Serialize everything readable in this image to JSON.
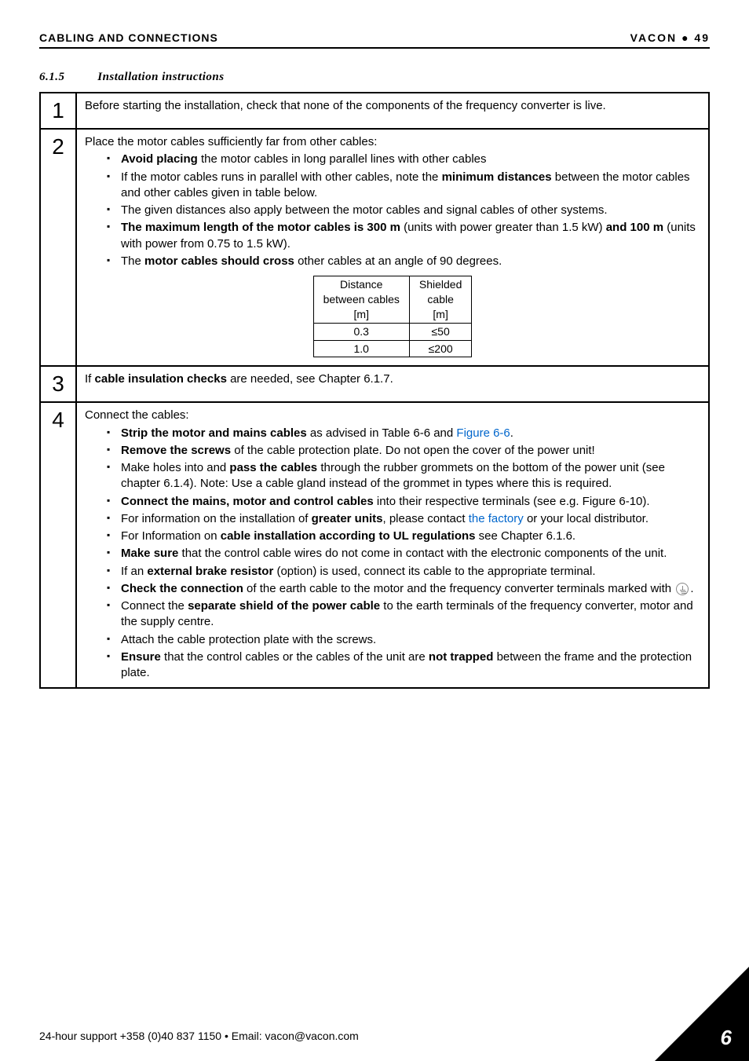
{
  "header": {
    "left": "CABLING AND CONNECTIONS",
    "right_brand": "VACON",
    "right_dot": "●",
    "right_page": "49"
  },
  "section": {
    "num": "6.1.5",
    "title": "Installation instructions"
  },
  "rows": {
    "r1": {
      "num": "1",
      "text": "Before starting the installation, check that none of the components of the frequency converter is live."
    },
    "r2": {
      "num": "2",
      "lead": "Place the motor cables sufficiently far from other cables:",
      "b1a": "Avoid placing",
      "b1b": " the motor cables in long parallel lines with other cables",
      "b2a": "If the motor cables runs in parallel with other cables, note the ",
      "b2b": "minimum distances",
      "b2c": " between the motor cables and other cables given in table below.",
      "b3": "The given distances also apply between the motor cables and signal cables of other systems.",
      "b4a": "The maximum length of the motor cables is 300 m",
      "b4b": " (units with power greater than 1.5 kW) ",
      "b4c": "and 100 m",
      "b4d": " (units with power from 0.75 to 1.5 kW).",
      "b5a": "The ",
      "b5b": "motor cables should cross",
      "b5c": " other cables at an angle of 90 degrees.",
      "tbl": {
        "h1a": "Distance",
        "h1b": "between cables",
        "h1c": "[m]",
        "h2a": "Shielded",
        "h2b": "cable",
        "h2c": "[m]",
        "r1c1": "0.3",
        "r1c2": "≤50",
        "r2c1": "1.0",
        "r2c2": "≤200"
      }
    },
    "r3": {
      "num": "3",
      "a": "If ",
      "b": "cable insulation checks",
      "c": " are needed, see Chapter 6.1.7."
    },
    "r4": {
      "num": "4",
      "lead": "Connect the cables:",
      "b1a": "Strip the motor and mains cables",
      "b1b": " as advised in Table 6-6 and ",
      "b1c": "Figure 6-6",
      "b1d": ".",
      "b2a": "Remove the screws",
      "b2b": " of the cable protection plate. Do not open the cover of the power unit!",
      "b3a": "Make holes into and ",
      "b3b": "pass the cables",
      "b3c": " through the rubber grommets on the bottom of the power unit (see chapter 6.1.4). Note: Use a cable gland instead of the grommet in types where this is required.",
      "b4a": "Connect the mains, motor and control cables",
      "b4b": " into their respective terminals (see e.g. Figure 6-10).",
      "b5a": "For information on the installation of ",
      "b5b": "greater units",
      "b5c": ", please contact ",
      "b5d": "the factory",
      "b5e": " or your local distributor.",
      "b6a": "For Information on ",
      "b6b": "cable installation according to UL regulations",
      "b6c": " see Chapter 6.1.6.",
      "b7a": "Make sure",
      "b7b": " that the control cable wires do not come in contact with the electronic components of the unit.",
      "b8a": "If an ",
      "b8b": "external brake resistor",
      "b8c": " (option) is used, connect its cable to the appropriate terminal.",
      "b9a": "Check the connection",
      "b9b": " of the earth cable to the motor and the frequency converter terminals marked with ",
      "b10a": "Connect the ",
      "b10b": "separate shield of the power cable",
      "b10c": " to the earth terminals of the frequency converter, motor and the supply centre.",
      "b11": "Attach the cable protection plate with the screws.",
      "b12a": "Ensure",
      "b12b": " that the control cables or the cables of the unit are ",
      "b12c": "not trapped",
      "b12d": " between the frame and the protection plate."
    }
  },
  "footer": {
    "text": "24-hour support +358 (0)40 837 1150 • Email: vacon@vacon.com",
    "chapter": "6"
  }
}
